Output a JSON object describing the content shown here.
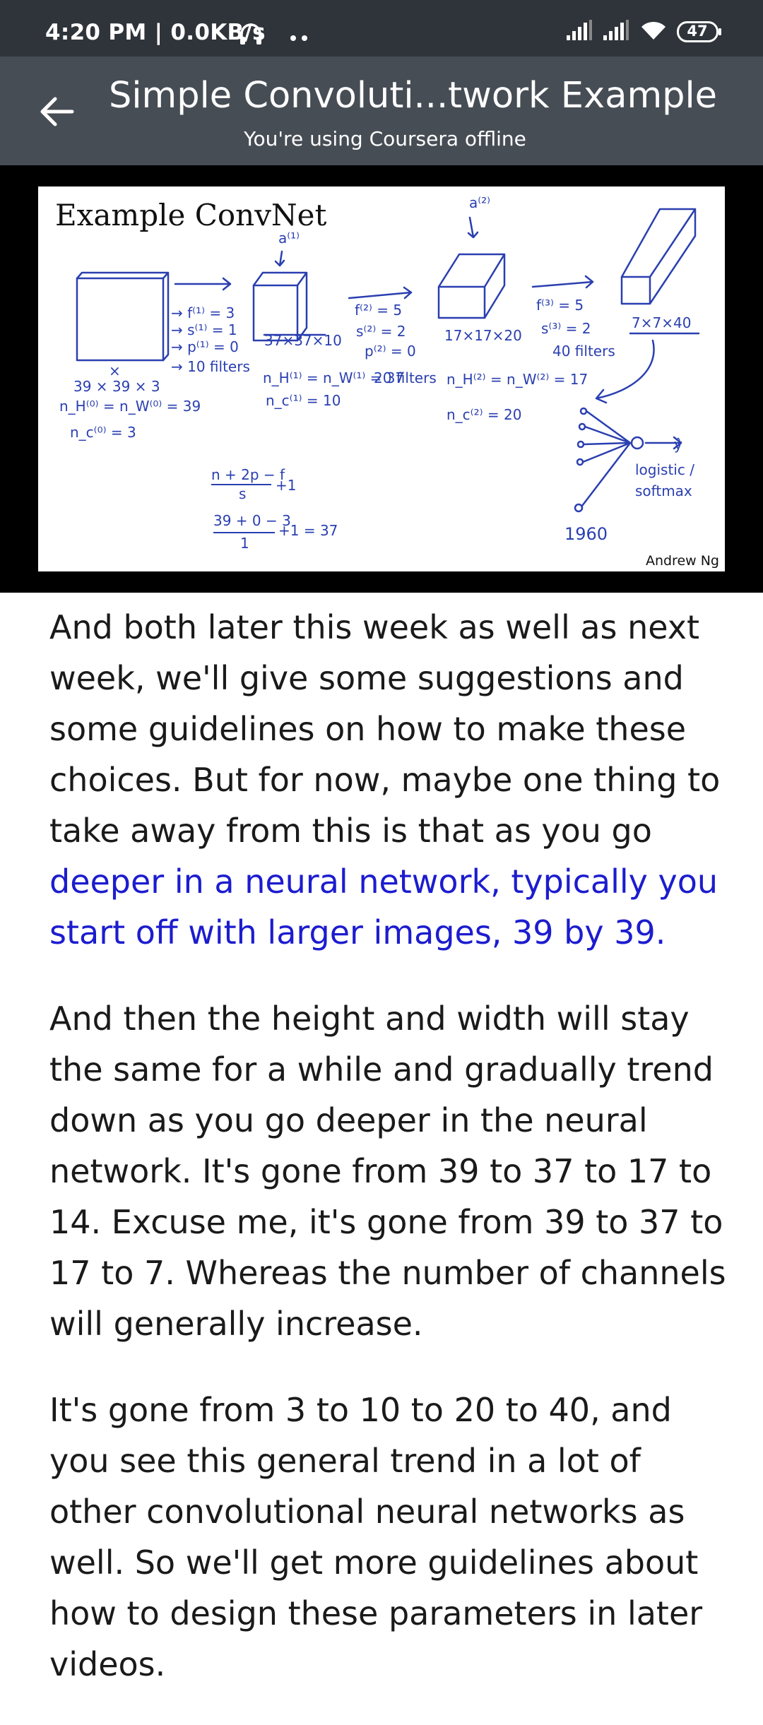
{
  "status_bar": {
    "time": "4:20 PM | 0.0KB/s",
    "battery": "47"
  },
  "app_bar": {
    "title": "Simple Convoluti...twork Example",
    "subtitle": "You're using Coursera offline"
  },
  "slide": {
    "title": "Example ConvNet",
    "credit": "Andrew Ng"
  },
  "transcript": {
    "p1_normal": "And both later this week as well as next week, we'll give some suggestions and some guidelines on how to make these choices. But for now, maybe one thing to take away from this is that as you go ",
    "p1_highlight": "deeper in a neural network, typically you start off with larger images, 39 by 39.",
    "p2": "And then the height and width will stay the same for a while and gradually trend down as you go deeper in the neural network. It's gone from 39 to 37 to 17 to 14. Excuse me, it's gone from 39 to 37 to 17 to 7. Whereas the number of channels will generally increase.",
    "p3": "It's gone from 3 to 10 to 20 to 40, and you see this general trend in a lot of other convolutional neural networks as well. So we'll get more guidelines about how to design these parameters in later videos."
  },
  "colors": {
    "status_bg": "#2f343a",
    "app_bar_bg": "#474d55",
    "highlight": "#1c1ccf",
    "handwriting": "#2a3fb0"
  }
}
